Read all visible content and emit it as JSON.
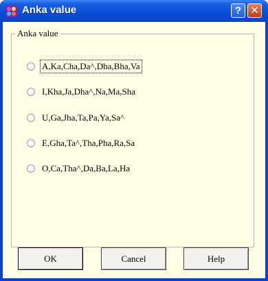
{
  "window": {
    "title": "Anka value",
    "help_glyph": "?",
    "close_glyph": "✕",
    "icon": "app-icon"
  },
  "group": {
    "label": "Anka value",
    "options": [
      {
        "label": "A,Ka,Cha,Da^,Dha,Bha,Va"
      },
      {
        "label": "I,Kha,Ja,Dha^,Na,Ma,Sha"
      },
      {
        "label": "U,Ga,Jha,Ta,Pa,Ya,Sa^"
      },
      {
        "label": "E,Gha,Ta^,Tha,Pha,Ra,Sa"
      },
      {
        "label": "O,Ca,Tha^,Da,Ba,La,Ha"
      }
    ]
  },
  "buttons": {
    "ok": "OK",
    "cancel": "Cancel",
    "help": "Help"
  },
  "colors": {
    "title_bar": "#0a4fd8",
    "client_bg": "#ffffe6",
    "close_button": "#c2391a"
  }
}
